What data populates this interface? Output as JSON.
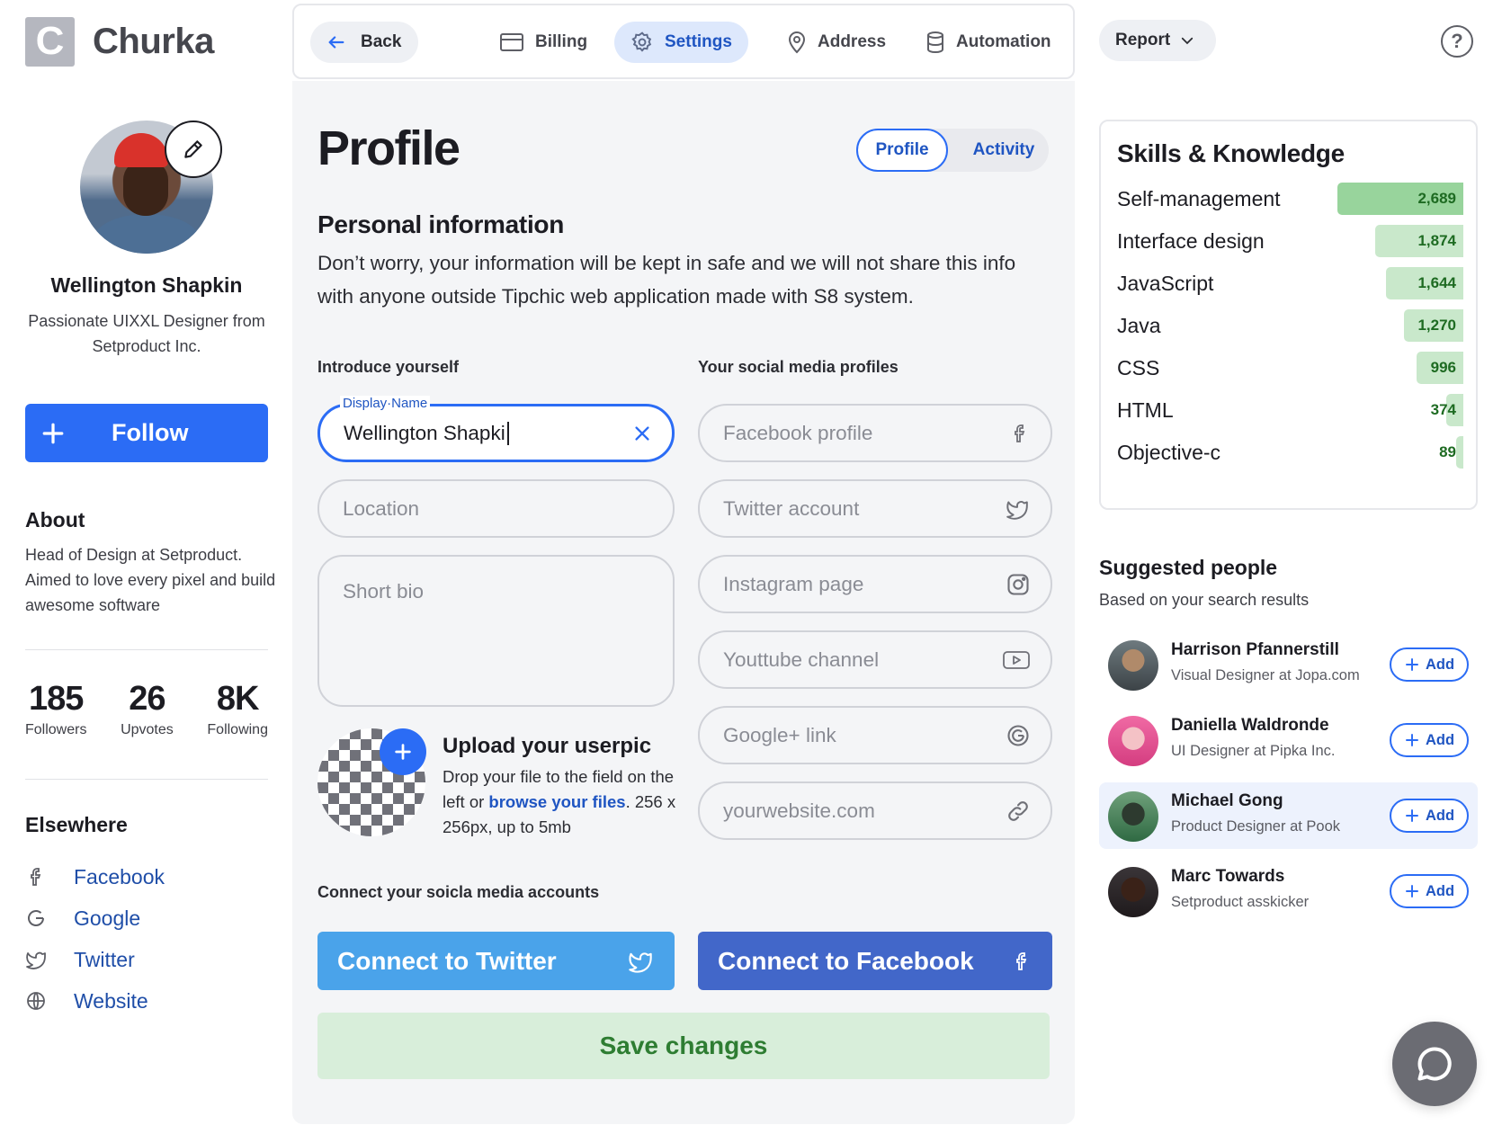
{
  "brand": {
    "logo_letter": "C",
    "name": "Churka"
  },
  "user": {
    "name": "Wellington Shapkin",
    "role": "Passionate UIXXL Designer from Setproduct Inc.",
    "follow_label": "Follow"
  },
  "about": {
    "title": "About",
    "text": "Head of Design at Setproduct. Aimed to love every pixel and build awesome software"
  },
  "stats": [
    {
      "value": "185",
      "label": "Followers"
    },
    {
      "value": "26",
      "label": "Upvotes"
    },
    {
      "value": "8K",
      "label": "Following"
    }
  ],
  "elsewhere": {
    "title": "Elsewhere",
    "items": [
      {
        "label": "Facebook",
        "icon": "facebook-icon"
      },
      {
        "label": "Google",
        "icon": "google-icon"
      },
      {
        "label": "Twitter",
        "icon": "twitter-icon"
      },
      {
        "label": "Website",
        "icon": "globe-icon"
      }
    ]
  },
  "nav": {
    "back": "Back",
    "tabs": [
      {
        "label": "Billing",
        "icon": "credit-card-icon"
      },
      {
        "label": "Settings",
        "icon": "gear-icon",
        "active": true
      },
      {
        "label": "Address",
        "icon": "location-pin-icon"
      },
      {
        "label": "Automation",
        "icon": "database-icon"
      }
    ],
    "report": "Report",
    "help": "?"
  },
  "page": {
    "title": "Profile",
    "segments": [
      "Profile",
      "Activity"
    ],
    "personal_title": "Personal information",
    "personal_text": "Don’t worry, your information will be kept in safe and we will not share this info with anyone outside Tipchic web application made with S8 system."
  },
  "intro": {
    "title": "Introduce yourself",
    "display_name_label": "Display·Name",
    "display_name_value": "Wellington Shapki",
    "location_placeholder": "Location",
    "bio_placeholder": "Short bio"
  },
  "social": {
    "title": "Your social media profiles",
    "fields": [
      {
        "placeholder": "Facebook profile",
        "icon": "facebook-icon"
      },
      {
        "placeholder": "Twitter account",
        "icon": "twitter-icon"
      },
      {
        "placeholder": "Instagram page",
        "icon": "instagram-icon"
      },
      {
        "placeholder": "Youttube channel",
        "icon": "youtube-icon"
      },
      {
        "placeholder": "Google+ link",
        "icon": "google-icon"
      },
      {
        "placeholder": "yourwebsite.com",
        "icon": "link-icon"
      }
    ]
  },
  "upload": {
    "title": "Upload your userpic",
    "text_before": "Drop your file to the field on the left or ",
    "link": "browse your files",
    "text_after": ". 256 x 256px, up to 5mb"
  },
  "connect": {
    "title": "Connect your soicla media accounts",
    "twitter": "Connect to Twitter",
    "facebook": "Connect to Facebook",
    "save": "Save changes",
    "twitter_color": "#4aa3ea",
    "facebook_color": "#4267c9"
  },
  "skills": {
    "title": "Skills & Knowledge",
    "max": 2689,
    "items": [
      {
        "name": "Self-management",
        "value": 2689,
        "label": "2,689"
      },
      {
        "name": "Interface design",
        "value": 1874,
        "label": "1,874"
      },
      {
        "name": "JavaScript",
        "value": 1644,
        "label": "1,644"
      },
      {
        "name": "Java",
        "value": 1270,
        "label": "1,270"
      },
      {
        "name": "CSS",
        "value": 996,
        "label": "996"
      },
      {
        "name": "HTML",
        "value": 374,
        "label": "374"
      },
      {
        "name": "Objective-c",
        "value": 89,
        "label": "89"
      }
    ]
  },
  "suggested": {
    "title": "Suggested people",
    "subtitle": "Based on your search results",
    "add_label": "Add",
    "people": [
      {
        "name": "Harrison Pfannerstill",
        "role": "Visual Designer at Jopa.com"
      },
      {
        "name": "Daniella Waldronde",
        "role": "UI Designer at Pipka Inc."
      },
      {
        "name": "Michael Gong",
        "role": "Product Designer at Pook",
        "highlight": true
      },
      {
        "name": "Marc Towards",
        "role": "Setproduct asskicker"
      }
    ]
  },
  "colors": {
    "accent": "#2b6cf5",
    "skill_bar": "#c9e8cb",
    "skill_text": "#1e6b22"
  }
}
